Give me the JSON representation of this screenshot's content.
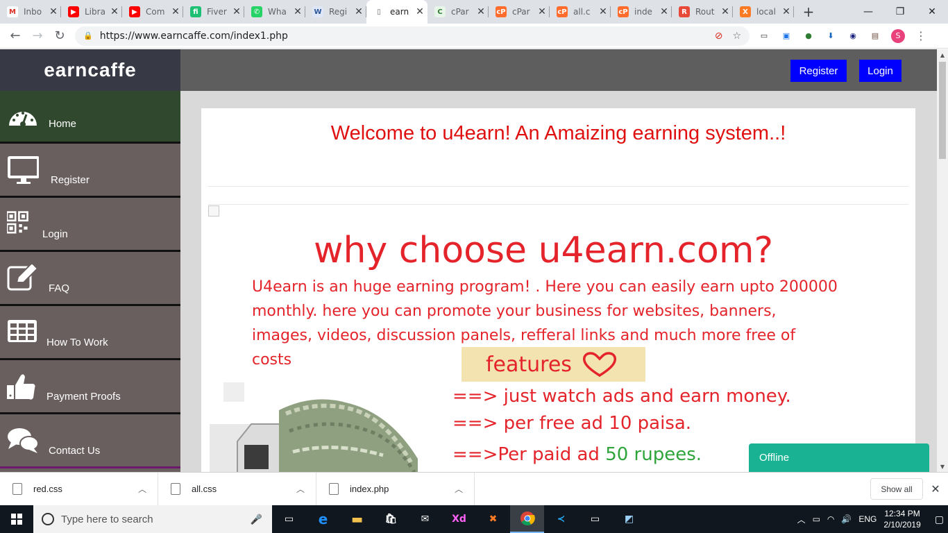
{
  "browser": {
    "tabs": [
      {
        "label": "Inbo",
        "icon": "gmail-icon",
        "color": "#ffffff",
        "glyph": "M",
        "glyph_color": "#d93025"
      },
      {
        "label": "Libra",
        "icon": "youtube-icon",
        "color": "#ff0000",
        "glyph": "▶",
        "glyph_color": "#ffffff"
      },
      {
        "label": "Com",
        "icon": "youtube-icon",
        "color": "#ff0000",
        "glyph": "▶",
        "glyph_color": "#ffffff"
      },
      {
        "label": "Fiver",
        "icon": "fiverr-icon",
        "color": "#1dbf73",
        "glyph": "fi",
        "glyph_color": "#ffffff"
      },
      {
        "label": "Wha",
        "icon": "whatsapp-icon",
        "color": "#25d366",
        "glyph": "✆",
        "glyph_color": "#ffffff"
      },
      {
        "label": "Regi",
        "icon": "word-icon",
        "color": "#dfe6f7",
        "glyph": "W",
        "glyph_color": "#2b579a"
      },
      {
        "label": "earn",
        "icon": "page-icon",
        "color": "#ffffff",
        "glyph": "▯",
        "glyph_color": "#5f6368"
      },
      {
        "label": "cPar",
        "icon": "cpanel-icon",
        "color": "#e8f5e9",
        "glyph": "C",
        "glyph_color": "#2e7d32"
      },
      {
        "label": "cPar",
        "icon": "cpanel-icon",
        "color": "#ff6c2c",
        "glyph": "cP",
        "glyph_color": "#ffffff"
      },
      {
        "label": "all.c",
        "icon": "cpanel-icon",
        "color": "#ff6c2c",
        "glyph": "cP",
        "glyph_color": "#ffffff"
      },
      {
        "label": "inde",
        "icon": "cpanel-icon",
        "color": "#ff6c2c",
        "glyph": "cP",
        "glyph_color": "#ffffff"
      },
      {
        "label": "Rout",
        "icon": "router-icon",
        "color": "#e84a3a",
        "glyph": "R",
        "glyph_color": "#ffffff"
      },
      {
        "label": "local",
        "icon": "xampp-icon",
        "color": "#fb7a24",
        "glyph": "X",
        "glyph_color": "#ffffff"
      }
    ],
    "active_tab": 6,
    "url": "https://www.earncaffe.com/index1.php"
  },
  "sidebar": {
    "brand": "earncaffe",
    "items": [
      {
        "label": "Home",
        "icon": "dashboard-icon"
      },
      {
        "label": "Register",
        "icon": "monitor-icon"
      },
      {
        "label": "Login",
        "icon": "qr-code-icon"
      },
      {
        "label": "FAQ",
        "icon": "edit-icon"
      },
      {
        "label": "How To Work",
        "icon": "table-icon"
      },
      {
        "label": "Payment Proofs",
        "icon": "thumbs-up-icon"
      },
      {
        "label": "Contact Us",
        "icon": "chat-bubbles-icon"
      }
    ]
  },
  "topbar": {
    "register_label": "Register",
    "login_label": "Login"
  },
  "main": {
    "welcome": "Welcome to u4earn! An Amaizing earning system..!",
    "why_title": "why choose u4earn.com?",
    "intro_line1": "U4earn is an huge earning program! . Here you can easily earn upto 200000",
    "intro_line2": "monthly. here you can promote your business for websites, banners,",
    "intro_line3": "images, videos, discussion panels, refferal links and much more free of",
    "intro_line4": "costs",
    "features_label": "features",
    "feature1": "==> just watch ads and earn money.",
    "feature2": "==> per free ad 10 paisa.",
    "feature3_prefix": "==>Per paid ad ",
    "feature3_highlight": "50 rupees.",
    "chat_status": "Offline"
  },
  "downloads": {
    "items": [
      "red.css",
      "all.css",
      "index.php"
    ],
    "show_all_label": "Show all"
  },
  "taskbar": {
    "search_placeholder": "Type here to search",
    "language": "ENG",
    "time": "12:34 PM",
    "date": "2/10/2019"
  },
  "colors": {
    "accent_red": "#e4232a",
    "button_blue": "#0000ff",
    "chat_green": "#19b394",
    "home_green": "#30482d"
  }
}
